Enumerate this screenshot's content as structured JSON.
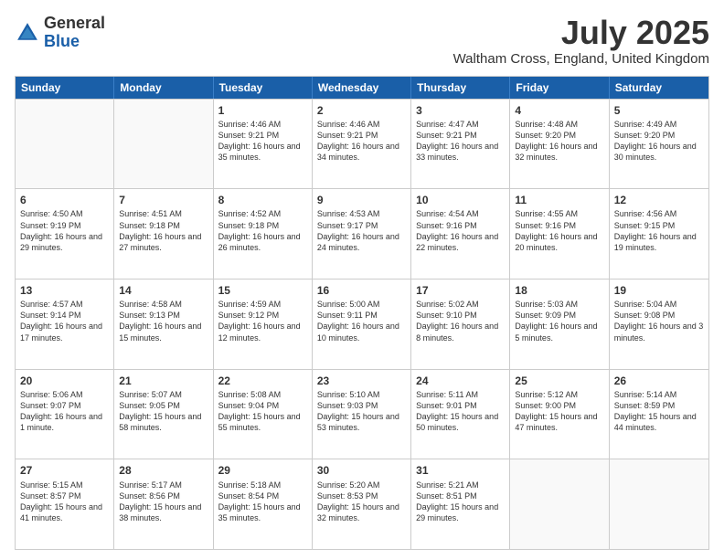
{
  "header": {
    "logo_general": "General",
    "logo_blue": "Blue",
    "month": "July 2025",
    "location": "Waltham Cross, England, United Kingdom"
  },
  "days_of_week": [
    "Sunday",
    "Monday",
    "Tuesday",
    "Wednesday",
    "Thursday",
    "Friday",
    "Saturday"
  ],
  "weeks": [
    [
      {
        "day": "",
        "sunrise": "",
        "sunset": "",
        "daylight": ""
      },
      {
        "day": "",
        "sunrise": "",
        "sunset": "",
        "daylight": ""
      },
      {
        "day": "1",
        "sunrise": "Sunrise: 4:46 AM",
        "sunset": "Sunset: 9:21 PM",
        "daylight": "Daylight: 16 hours and 35 minutes."
      },
      {
        "day": "2",
        "sunrise": "Sunrise: 4:46 AM",
        "sunset": "Sunset: 9:21 PM",
        "daylight": "Daylight: 16 hours and 34 minutes."
      },
      {
        "day": "3",
        "sunrise": "Sunrise: 4:47 AM",
        "sunset": "Sunset: 9:21 PM",
        "daylight": "Daylight: 16 hours and 33 minutes."
      },
      {
        "day": "4",
        "sunrise": "Sunrise: 4:48 AM",
        "sunset": "Sunset: 9:20 PM",
        "daylight": "Daylight: 16 hours and 32 minutes."
      },
      {
        "day": "5",
        "sunrise": "Sunrise: 4:49 AM",
        "sunset": "Sunset: 9:20 PM",
        "daylight": "Daylight: 16 hours and 30 minutes."
      }
    ],
    [
      {
        "day": "6",
        "sunrise": "Sunrise: 4:50 AM",
        "sunset": "Sunset: 9:19 PM",
        "daylight": "Daylight: 16 hours and 29 minutes."
      },
      {
        "day": "7",
        "sunrise": "Sunrise: 4:51 AM",
        "sunset": "Sunset: 9:18 PM",
        "daylight": "Daylight: 16 hours and 27 minutes."
      },
      {
        "day": "8",
        "sunrise": "Sunrise: 4:52 AM",
        "sunset": "Sunset: 9:18 PM",
        "daylight": "Daylight: 16 hours and 26 minutes."
      },
      {
        "day": "9",
        "sunrise": "Sunrise: 4:53 AM",
        "sunset": "Sunset: 9:17 PM",
        "daylight": "Daylight: 16 hours and 24 minutes."
      },
      {
        "day": "10",
        "sunrise": "Sunrise: 4:54 AM",
        "sunset": "Sunset: 9:16 PM",
        "daylight": "Daylight: 16 hours and 22 minutes."
      },
      {
        "day": "11",
        "sunrise": "Sunrise: 4:55 AM",
        "sunset": "Sunset: 9:16 PM",
        "daylight": "Daylight: 16 hours and 20 minutes."
      },
      {
        "day": "12",
        "sunrise": "Sunrise: 4:56 AM",
        "sunset": "Sunset: 9:15 PM",
        "daylight": "Daylight: 16 hours and 19 minutes."
      }
    ],
    [
      {
        "day": "13",
        "sunrise": "Sunrise: 4:57 AM",
        "sunset": "Sunset: 9:14 PM",
        "daylight": "Daylight: 16 hours and 17 minutes."
      },
      {
        "day": "14",
        "sunrise": "Sunrise: 4:58 AM",
        "sunset": "Sunset: 9:13 PM",
        "daylight": "Daylight: 16 hours and 15 minutes."
      },
      {
        "day": "15",
        "sunrise": "Sunrise: 4:59 AM",
        "sunset": "Sunset: 9:12 PM",
        "daylight": "Daylight: 16 hours and 12 minutes."
      },
      {
        "day": "16",
        "sunrise": "Sunrise: 5:00 AM",
        "sunset": "Sunset: 9:11 PM",
        "daylight": "Daylight: 16 hours and 10 minutes."
      },
      {
        "day": "17",
        "sunrise": "Sunrise: 5:02 AM",
        "sunset": "Sunset: 9:10 PM",
        "daylight": "Daylight: 16 hours and 8 minutes."
      },
      {
        "day": "18",
        "sunrise": "Sunrise: 5:03 AM",
        "sunset": "Sunset: 9:09 PM",
        "daylight": "Daylight: 16 hours and 5 minutes."
      },
      {
        "day": "19",
        "sunrise": "Sunrise: 5:04 AM",
        "sunset": "Sunset: 9:08 PM",
        "daylight": "Daylight: 16 hours and 3 minutes."
      }
    ],
    [
      {
        "day": "20",
        "sunrise": "Sunrise: 5:06 AM",
        "sunset": "Sunset: 9:07 PM",
        "daylight": "Daylight: 16 hours and 1 minute."
      },
      {
        "day": "21",
        "sunrise": "Sunrise: 5:07 AM",
        "sunset": "Sunset: 9:05 PM",
        "daylight": "Daylight: 15 hours and 58 minutes."
      },
      {
        "day": "22",
        "sunrise": "Sunrise: 5:08 AM",
        "sunset": "Sunset: 9:04 PM",
        "daylight": "Daylight: 15 hours and 55 minutes."
      },
      {
        "day": "23",
        "sunrise": "Sunrise: 5:10 AM",
        "sunset": "Sunset: 9:03 PM",
        "daylight": "Daylight: 15 hours and 53 minutes."
      },
      {
        "day": "24",
        "sunrise": "Sunrise: 5:11 AM",
        "sunset": "Sunset: 9:01 PM",
        "daylight": "Daylight: 15 hours and 50 minutes."
      },
      {
        "day": "25",
        "sunrise": "Sunrise: 5:12 AM",
        "sunset": "Sunset: 9:00 PM",
        "daylight": "Daylight: 15 hours and 47 minutes."
      },
      {
        "day": "26",
        "sunrise": "Sunrise: 5:14 AM",
        "sunset": "Sunset: 8:59 PM",
        "daylight": "Daylight: 15 hours and 44 minutes."
      }
    ],
    [
      {
        "day": "27",
        "sunrise": "Sunrise: 5:15 AM",
        "sunset": "Sunset: 8:57 PM",
        "daylight": "Daylight: 15 hours and 41 minutes."
      },
      {
        "day": "28",
        "sunrise": "Sunrise: 5:17 AM",
        "sunset": "Sunset: 8:56 PM",
        "daylight": "Daylight: 15 hours and 38 minutes."
      },
      {
        "day": "29",
        "sunrise": "Sunrise: 5:18 AM",
        "sunset": "Sunset: 8:54 PM",
        "daylight": "Daylight: 15 hours and 35 minutes."
      },
      {
        "day": "30",
        "sunrise": "Sunrise: 5:20 AM",
        "sunset": "Sunset: 8:53 PM",
        "daylight": "Daylight: 15 hours and 32 minutes."
      },
      {
        "day": "31",
        "sunrise": "Sunrise: 5:21 AM",
        "sunset": "Sunset: 8:51 PM",
        "daylight": "Daylight: 15 hours and 29 minutes."
      },
      {
        "day": "",
        "sunrise": "",
        "sunset": "",
        "daylight": ""
      },
      {
        "day": "",
        "sunrise": "",
        "sunset": "",
        "daylight": ""
      }
    ]
  ]
}
